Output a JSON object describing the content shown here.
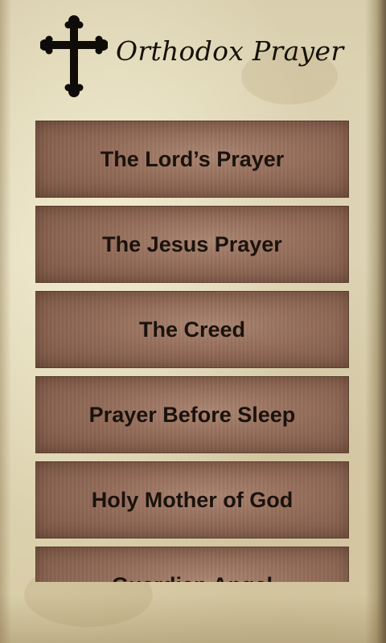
{
  "app": {
    "title": "Orthodox Prayer",
    "icon": "orthodox-cross-icon"
  },
  "prayers": [
    {
      "label": "The Lord’s Prayer"
    },
    {
      "label": "The Jesus Prayer"
    },
    {
      "label": "The Creed"
    },
    {
      "label": "Prayer Before Sleep"
    },
    {
      "label": "Holy Mother of God"
    },
    {
      "label": "Guardian Angel"
    }
  ],
  "colors": {
    "parchment": "#e3dbbd",
    "button_wood": "#946c59",
    "text": "#1a120c"
  }
}
